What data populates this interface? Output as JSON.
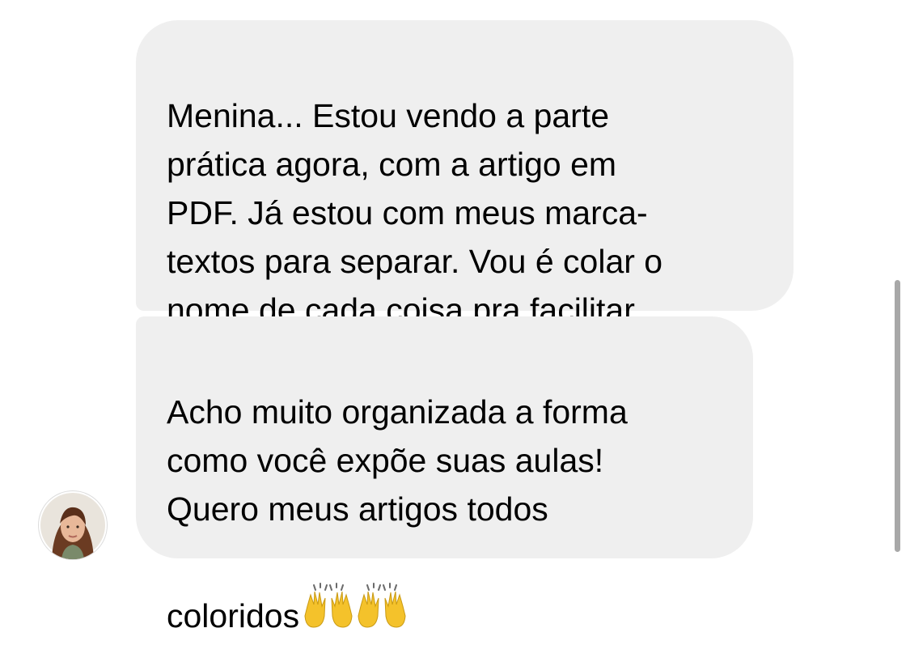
{
  "conversation": {
    "messages": [
      {
        "text": "Menina... Estou vendo a parte\nprática agora, com a artigo em\nPDF. Já estou com meus marca-\ntextos para separar. Vou é colar o\nnome de cada coisa pra facilitar",
        "emoji": []
      },
      {
        "text": "Acho muito organizada a forma\ncomo você expõe suas aulas!\nQuero meus artigos todos\ncoloridos",
        "emoji": [
          "raising-hands-icon",
          "raising-hands-icon"
        ]
      }
    ],
    "sender": {
      "avatar_icon": "profile-photo-icon"
    }
  },
  "colors": {
    "bubble_background": "#efefef",
    "text": "#000000",
    "scrollbar": "#a8a8a8",
    "emoji": "#f4c22b"
  }
}
